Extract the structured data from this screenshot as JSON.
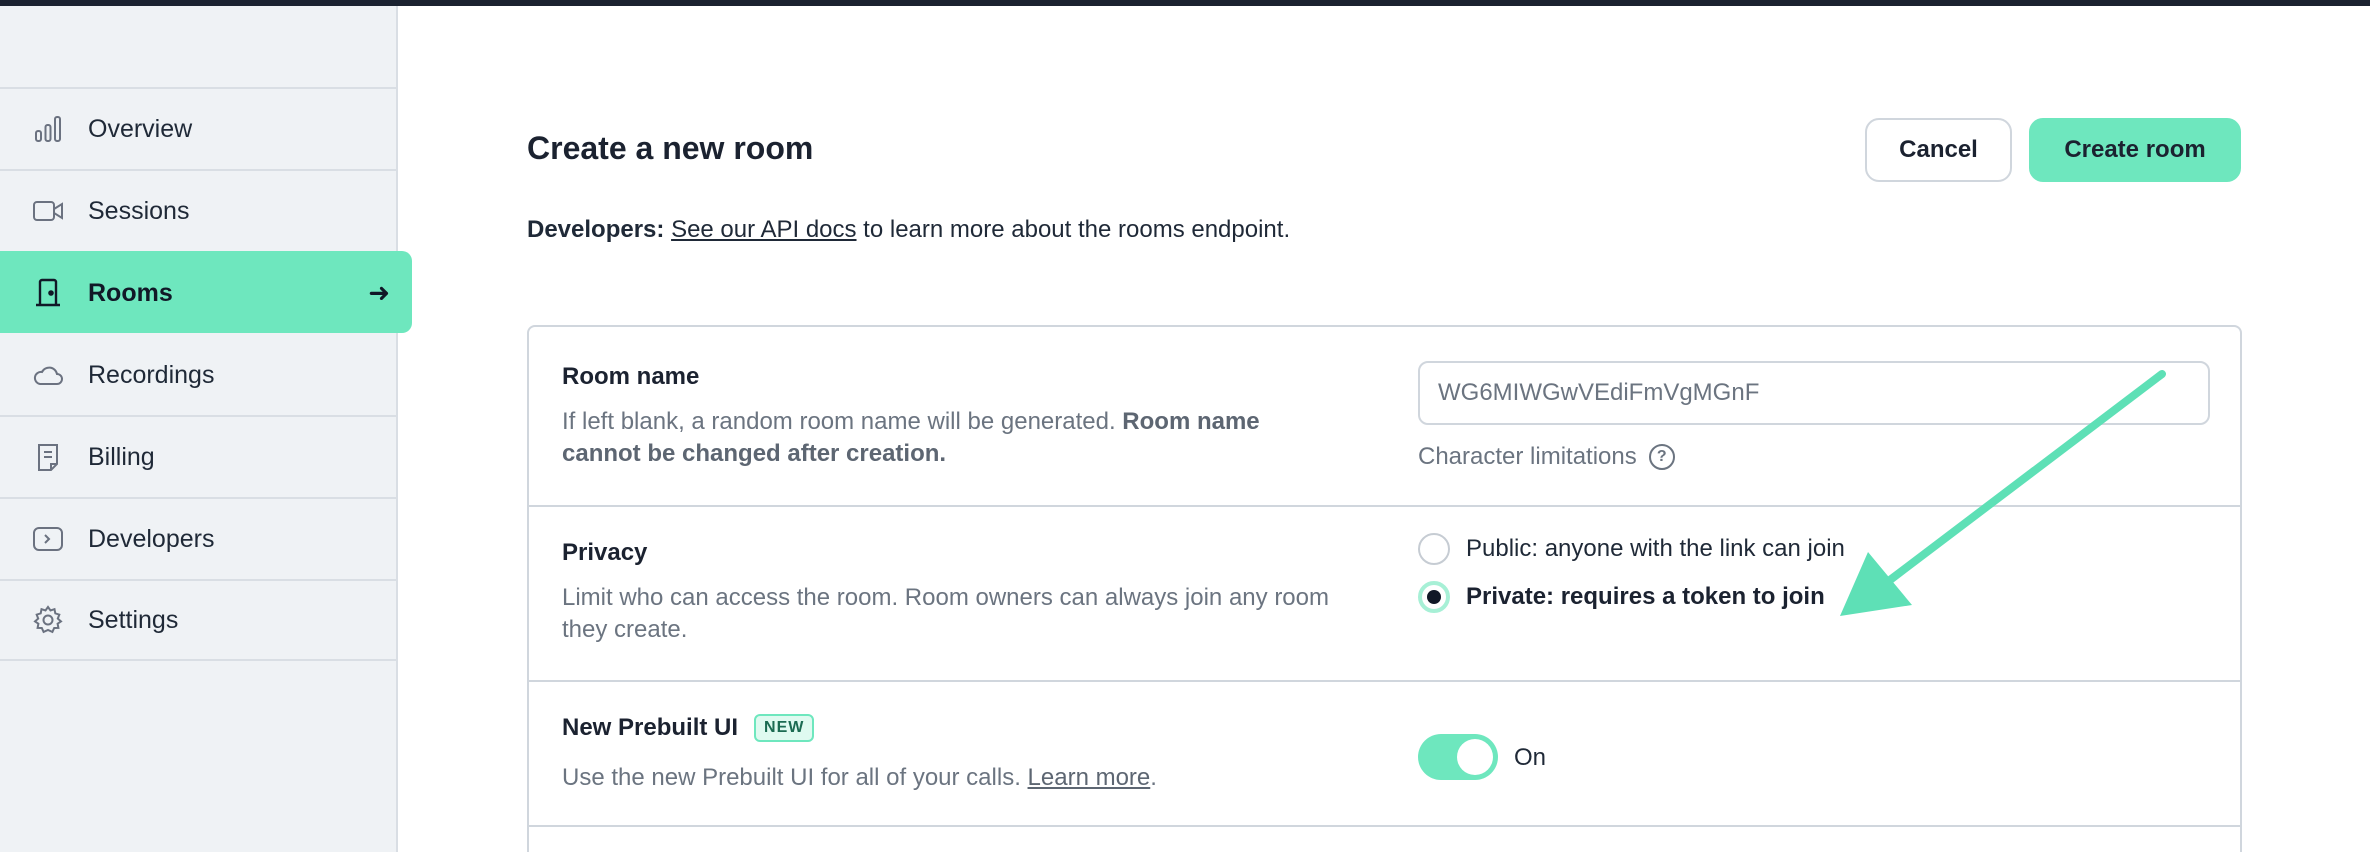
{
  "sidebar": {
    "items": [
      {
        "label": "Overview",
        "icon": "bar-chart-icon",
        "active": false
      },
      {
        "label": "Sessions",
        "icon": "video-camera-icon",
        "active": false
      },
      {
        "label": "Rooms",
        "icon": "door-icon",
        "active": true
      },
      {
        "label": "Recordings",
        "icon": "cloud-icon",
        "active": false
      },
      {
        "label": "Billing",
        "icon": "receipt-icon",
        "active": false
      },
      {
        "label": "Developers",
        "icon": "code-icon",
        "active": false
      },
      {
        "label": "Settings",
        "icon": "gear-icon",
        "active": false
      }
    ],
    "active_arrow": "➜"
  },
  "header": {
    "title": "Create a new room",
    "cancel_label": "Cancel",
    "create_label": "Create room"
  },
  "developers_line": {
    "prefix": "Developers:",
    "link": "See our API docs",
    "suffix": " to learn more about the rooms endpoint."
  },
  "room_name": {
    "title": "Room name",
    "desc": "If left blank, a random room name will be generated. ",
    "desc_bold": "Room name cannot be changed after creation.",
    "value": "WG6MIWGwVEdiFmVgMGnF",
    "char_limitations": "Character limitations",
    "help_icon": "?"
  },
  "privacy": {
    "title": "Privacy",
    "desc": "Limit who can access the room. Room owners can always join any room they create.",
    "options": [
      {
        "label": "Public: anyone with the link can join",
        "selected": false
      },
      {
        "label": "Private: requires a token to join",
        "selected": true
      }
    ]
  },
  "prebuilt": {
    "title": "New Prebuilt UI",
    "badge": "NEW",
    "desc": "Use the new Prebuilt UI for all of your calls. ",
    "link": "Learn more",
    "desc_end": ".",
    "toggle_on": true,
    "toggle_label": "On"
  },
  "colors": {
    "accent": "#6ee7be",
    "annotation_arrow": "#5ee0b6",
    "topbar": "#1b2230"
  }
}
